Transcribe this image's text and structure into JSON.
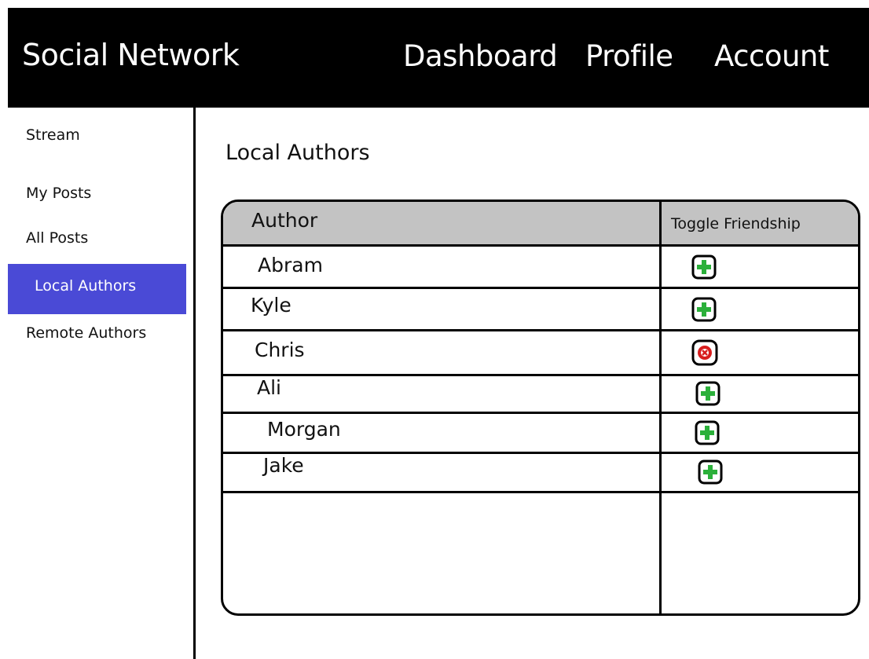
{
  "header": {
    "brand": "Social Network",
    "nav": [
      "Dashboard",
      "Profile",
      "Account"
    ]
  },
  "sidebar": {
    "items": [
      {
        "label": "Stream",
        "active": false
      },
      {
        "label": "My Posts",
        "active": false
      },
      {
        "label": "All Posts",
        "active": false
      },
      {
        "label": "Local Authors",
        "active": true
      },
      {
        "label": "Remote Authors",
        "active": false
      }
    ]
  },
  "main": {
    "title": "Local Authors",
    "table": {
      "columns": [
        "Author",
        "Toggle Friendship"
      ],
      "rows": [
        {
          "name": "Abram",
          "action": "add-friend-icon"
        },
        {
          "name": "Kyle",
          "action": "add-friend-icon"
        },
        {
          "name": "Chris",
          "action": "remove-friend-icon"
        },
        {
          "name": "Ali",
          "action": "add-friend-icon"
        },
        {
          "name": "Morgan",
          "action": "add-friend-icon"
        },
        {
          "name": "Jake",
          "action": "add-friend-icon"
        }
      ]
    }
  },
  "colors": {
    "header_bg": "#000000",
    "active_sidebar_bg": "#4a4ad6",
    "table_header_bg": "#c3c3c3",
    "add_green": "#2bb03a",
    "remove_red": "#d81e1e"
  }
}
